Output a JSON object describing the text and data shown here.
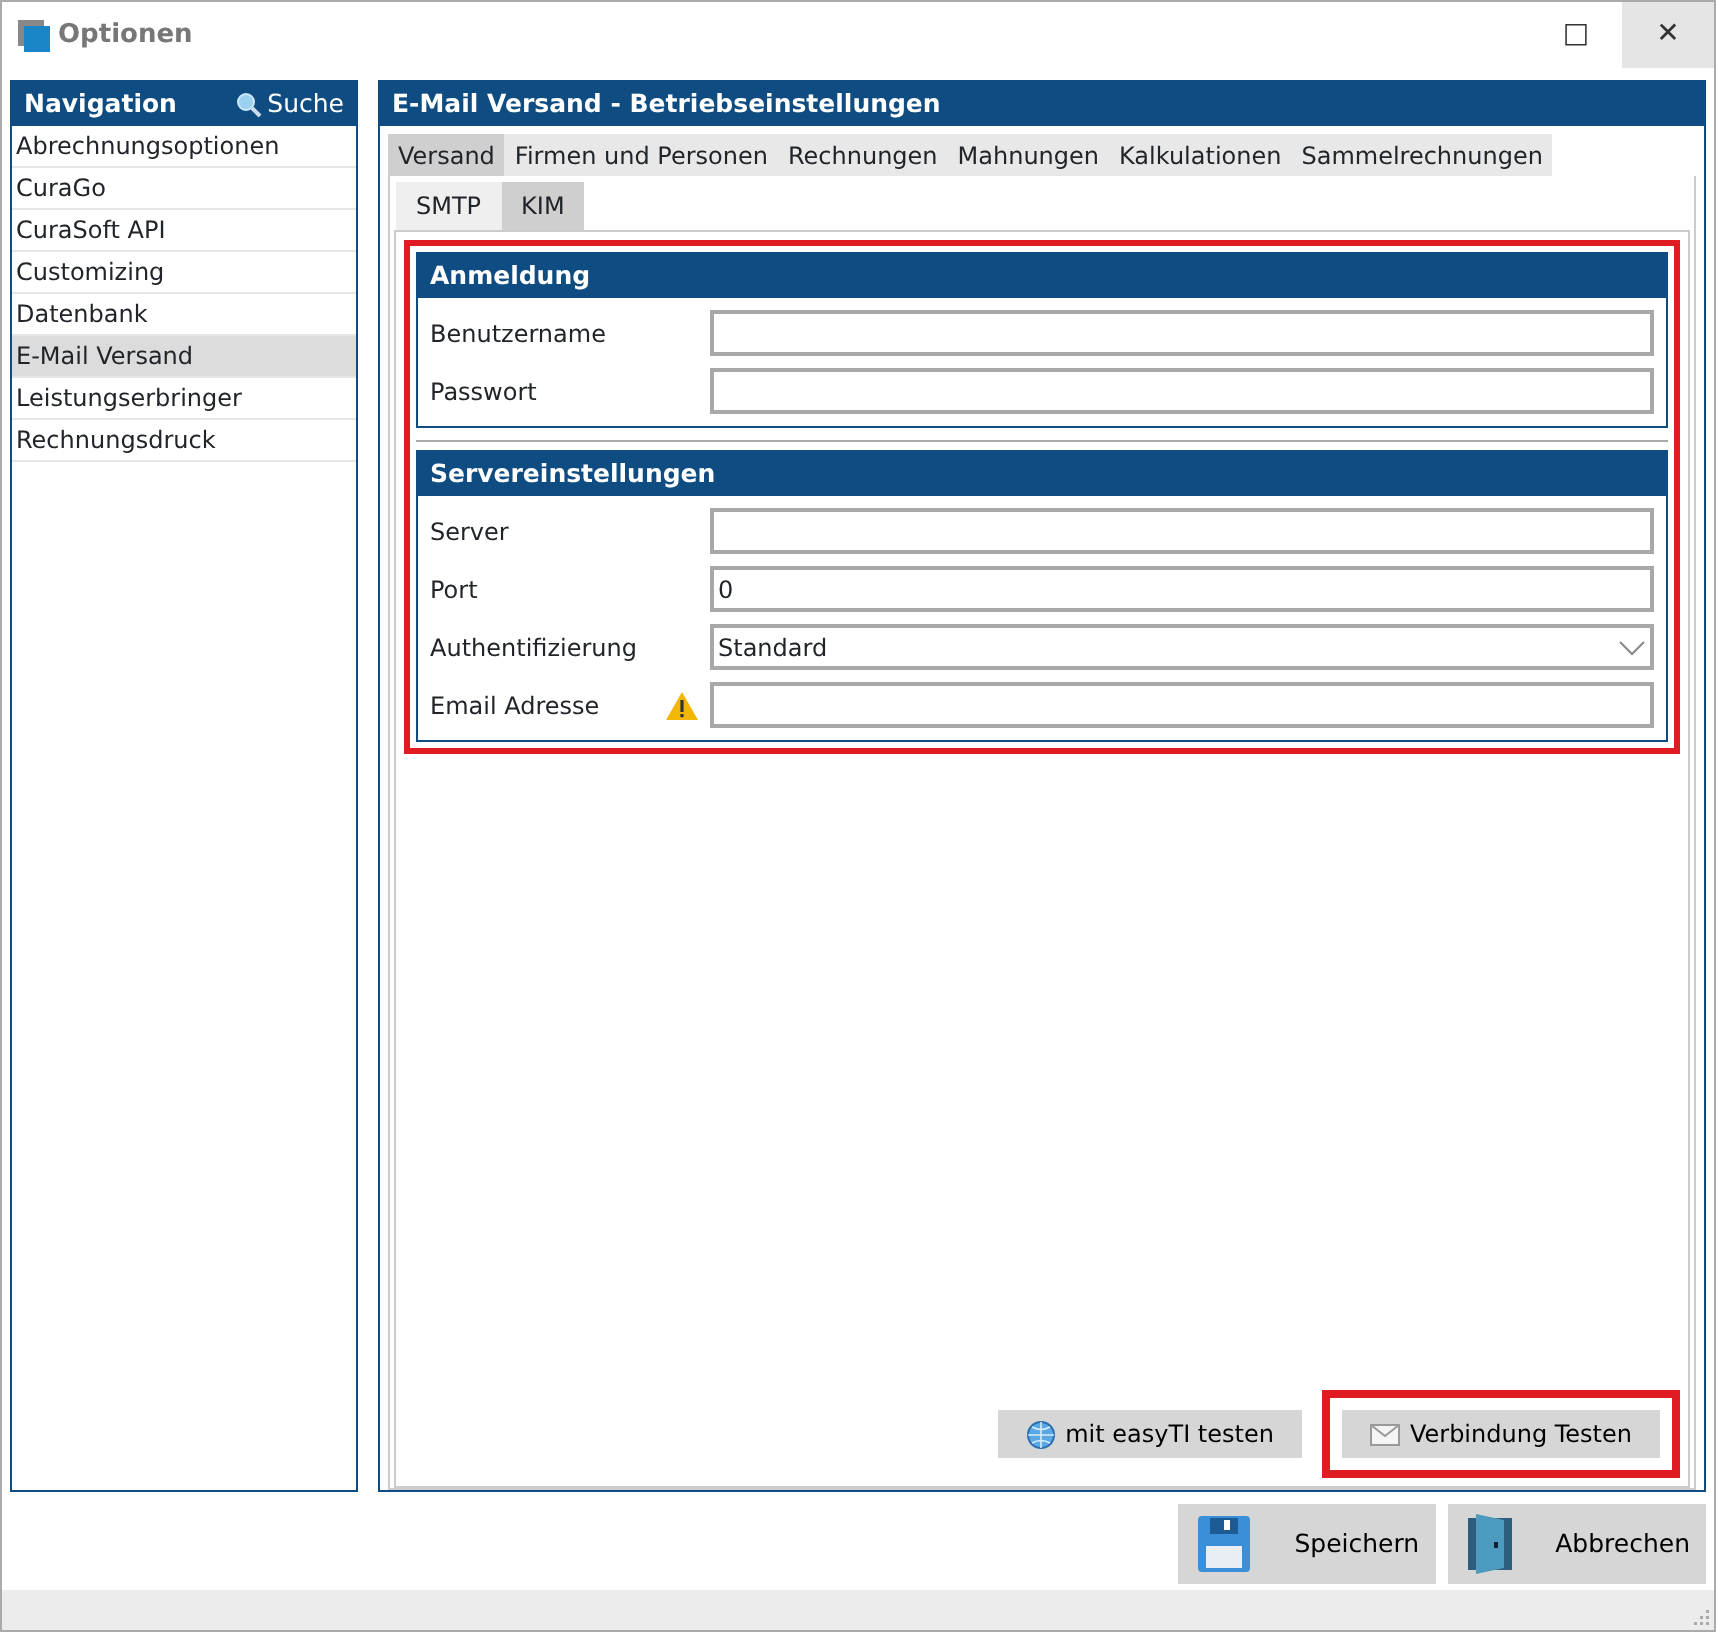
{
  "window": {
    "title": "Optionen",
    "buttons": [
      "□",
      "✕"
    ]
  },
  "navigation": {
    "title": "Navigation",
    "search": "Suche",
    "items": [
      {
        "label": "Abrechnungsoptionen",
        "selected": false
      },
      {
        "label": "CuraGo",
        "selected": false
      },
      {
        "label": "CuraSoft API",
        "selected": false
      },
      {
        "label": "Customizing",
        "selected": false
      },
      {
        "label": "Datenbank",
        "selected": false
      },
      {
        "label": "E-Mail Versand",
        "selected": true
      },
      {
        "label": "Leistungserbringer",
        "selected": false
      },
      {
        "label": "Rechnungsdruck",
        "selected": false
      }
    ]
  },
  "panel": {
    "title": "E-Mail Versand - Betriebseinstellungen",
    "tabs": [
      {
        "label": "Versand",
        "selected": true
      },
      {
        "label": "Firmen und Personen",
        "selected": false
      },
      {
        "label": "Rechnungen",
        "selected": false
      },
      {
        "label": "Mahnungen",
        "selected": false
      },
      {
        "label": "Kalkulationen",
        "selected": false
      },
      {
        "label": "Sammelrechnungen",
        "selected": false
      }
    ],
    "subtabs": [
      {
        "label": "SMTP",
        "selected": false
      },
      {
        "label": "KIM",
        "selected": true
      }
    ],
    "form": {
      "highlighted": true,
      "sections": [
        {
          "title": "Anmeldung",
          "fields": [
            {
              "label": "Benutzername",
              "kind": "text",
              "warning": false
            },
            {
              "label": "Passwort",
              "kind": "text",
              "warning": false
            }
          ]
        },
        {
          "title": "Servereinstellungen",
          "fields": [
            {
              "label": "Server",
              "kind": "text",
              "warning": false
            },
            {
              "label": "Port",
              "kind": "text",
              "value": "0",
              "warning": false
            },
            {
              "label": "Authentifizierung",
              "kind": "select",
              "value": "Standard",
              "warning": false
            },
            {
              "label": "Email Adresse",
              "kind": "text",
              "warning": true
            }
          ]
        }
      ]
    },
    "actions": [
      {
        "label": "mit easyTI testen",
        "kind": "globe",
        "highlighted": false
      },
      {
        "label": "Verbindung Testen",
        "kind": "mail",
        "highlighted": true
      }
    ]
  },
  "footer_buttons": [
    {
      "label": "Speichern",
      "kind": "save"
    },
    {
      "label": "Abbrechen",
      "kind": "door"
    }
  ]
}
